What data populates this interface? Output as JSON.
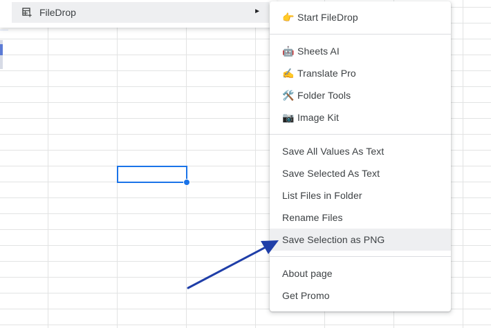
{
  "parent_menu": {
    "item_label": "FileDrop",
    "item_icon": "addon-table-icon",
    "submenu_arrow": "►"
  },
  "submenu": {
    "start": {
      "icon": "👉",
      "label": "Start FileDrop"
    },
    "addons": [
      {
        "icon": "🤖",
        "label": "Sheets AI"
      },
      {
        "icon": "✍️",
        "label": "Translate Pro"
      },
      {
        "icon": "🛠️",
        "label": "Folder Tools"
      },
      {
        "icon": "📷",
        "label": "Image Kit"
      }
    ],
    "actions": [
      {
        "label": "Save All Values As Text"
      },
      {
        "label": "Save Selected As Text"
      },
      {
        "label": "List Files in Folder"
      },
      {
        "label": "Rename Files"
      },
      {
        "label": "Save Selection as PNG"
      }
    ],
    "footer": [
      {
        "label": "About page"
      },
      {
        "label": "Get Promo"
      }
    ]
  },
  "colors": {
    "selection": "#1a73e8",
    "annotation_arrow": "#1f3ea8",
    "menu_highlight": "#eeeff1"
  }
}
